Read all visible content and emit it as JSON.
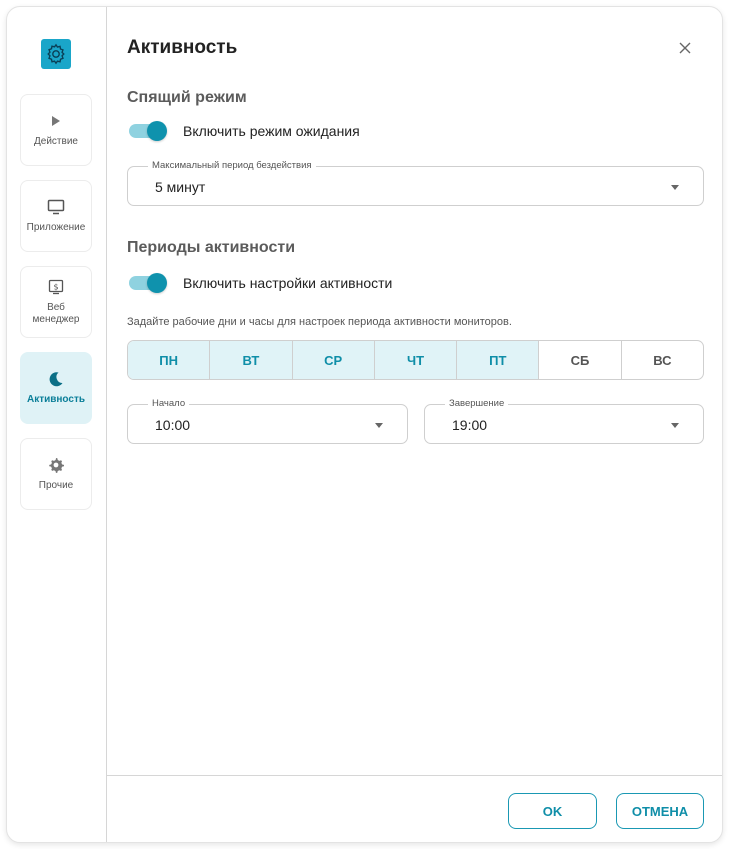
{
  "dialog": {
    "title": "Активность",
    "sleep_section": {
      "title": "Спящий режим",
      "toggle_label": "Включить режим ожидания",
      "toggle_on": true,
      "idle_period": {
        "label": "Максимальный период бездействия",
        "value": "5 минут"
      }
    },
    "activity_section": {
      "title": "Периоды активности",
      "toggle_label": "Включить настройки активности",
      "toggle_on": true,
      "hint": "Задайте рабочие дни и часы для настроек периода активности мониторов.",
      "days": [
        {
          "label": "ПН",
          "selected": true
        },
        {
          "label": "ВТ",
          "selected": true
        },
        {
          "label": "СР",
          "selected": true
        },
        {
          "label": "ЧТ",
          "selected": true
        },
        {
          "label": "ПТ",
          "selected": true
        },
        {
          "label": "СБ",
          "selected": false
        },
        {
          "label": "ВС",
          "selected": false
        }
      ],
      "start": {
        "label": "Начало",
        "value": "10:00"
      },
      "end": {
        "label": "Завершение",
        "value": "19:00"
      }
    },
    "buttons": {
      "ok": "OK",
      "cancel": "ОТМЕНА"
    }
  },
  "sidebar": {
    "items": [
      {
        "label": "Действие",
        "icon": "play-icon",
        "active": false
      },
      {
        "label": "Приложение",
        "icon": "monitor-icon",
        "active": false
      },
      {
        "label": "Веб менеджер",
        "icon": "web-manager-icon",
        "active": false
      },
      {
        "label": "Активность",
        "icon": "moon-icon",
        "active": true
      },
      {
        "label": "Прочие",
        "icon": "gear-icon",
        "active": false
      }
    ]
  },
  "colors": {
    "accent": "#0f92ad",
    "accent_light": "#dff2f6",
    "toggle_track": "#8fd2e0"
  }
}
